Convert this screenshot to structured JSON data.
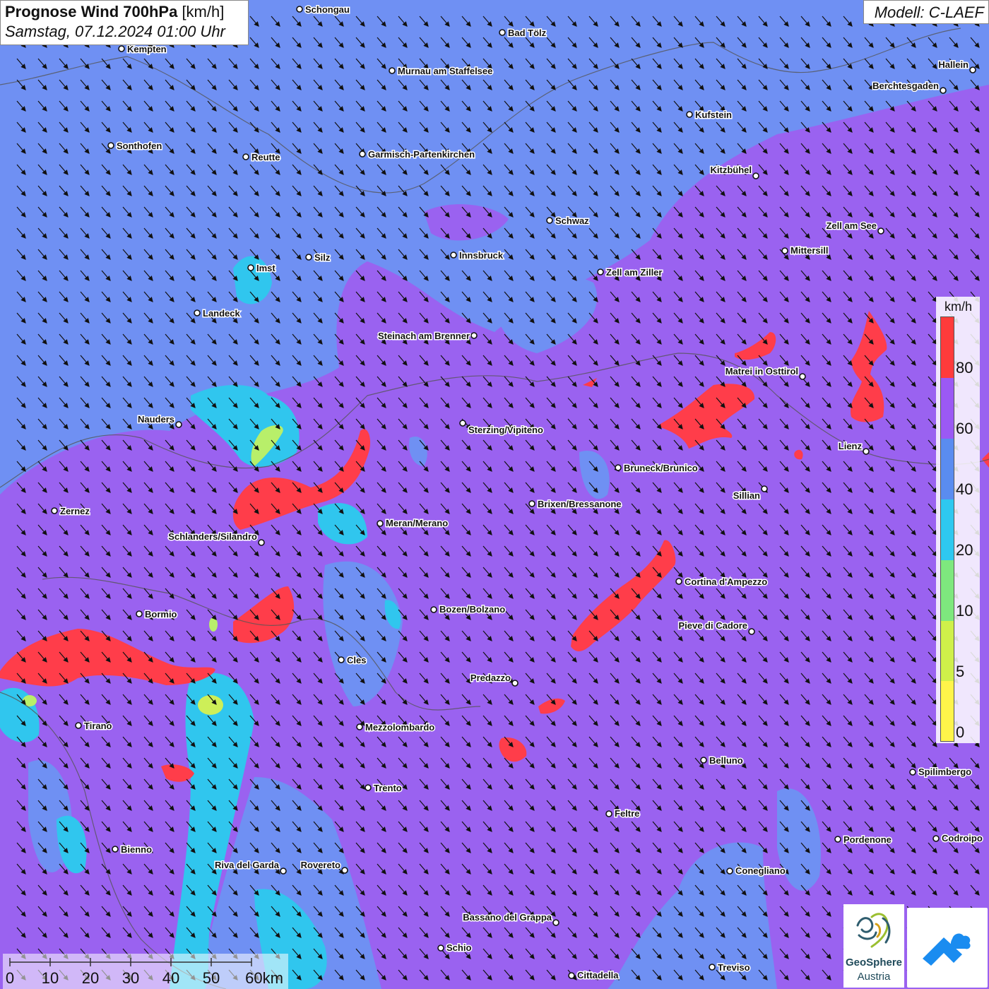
{
  "header": {
    "title": "Prognose Wind 700hPa",
    "unit": "[km/h]",
    "datetime": "Samstag, 07.12.2024 01:00 Uhr"
  },
  "model": {
    "label": "Modell: C-LAEF"
  },
  "legend": {
    "unit": "km/h",
    "ticks": [
      "80",
      "60",
      "40",
      "20",
      "10",
      "5",
      "0"
    ],
    "colors": [
      "#ff3b3b",
      "#9b59f4",
      "#5a8cf0",
      "#2ec8f0",
      "#7ee87e",
      "#cff04a",
      "#fff44a"
    ]
  },
  "scale": {
    "ticks": [
      "0",
      "10",
      "20",
      "30",
      "40",
      "50",
      "60km"
    ]
  },
  "branding": {
    "name_line1": "GeoSphere",
    "name_line2": "Austria"
  },
  "wind_direction": "northwest",
  "cities": [
    {
      "name": "Schongau"
    },
    {
      "name": "Bad Tölz"
    },
    {
      "name": "Kempten"
    },
    {
      "name": "Murnau am Staffelsee"
    },
    {
      "name": "Hallein"
    },
    {
      "name": "Berchtesgaden"
    },
    {
      "name": "Kufstein"
    },
    {
      "name": "Sonthofen"
    },
    {
      "name": "Reutte"
    },
    {
      "name": "Garmisch-Partenkirchen"
    },
    {
      "name": "Kitzbühel"
    },
    {
      "name": "Schwaz"
    },
    {
      "name": "Zell am See"
    },
    {
      "name": "Mittersill"
    },
    {
      "name": "Innsbruck"
    },
    {
      "name": "Silz"
    },
    {
      "name": "Imst"
    },
    {
      "name": "Zell am Ziller"
    },
    {
      "name": "Landeck"
    },
    {
      "name": "Steinach am Brenner"
    },
    {
      "name": "Matrei in Osttirol"
    },
    {
      "name": "Nauders"
    },
    {
      "name": "Sterzing/Vipiteno"
    },
    {
      "name": "Lienz"
    },
    {
      "name": "Bruneck/Brunico"
    },
    {
      "name": "Sillian"
    },
    {
      "name": "Brixen/Bressanone"
    },
    {
      "name": "Zernez"
    },
    {
      "name": "Meran/Merano"
    },
    {
      "name": "Schlanders/Silandro"
    },
    {
      "name": "Cortina d'Ampezzo"
    },
    {
      "name": "Bozen/Bolzano"
    },
    {
      "name": "Bormio"
    },
    {
      "name": "Pieve di Cadore"
    },
    {
      "name": "Cles"
    },
    {
      "name": "Predazzo"
    },
    {
      "name": "Tirano"
    },
    {
      "name": "Mezzolombardo"
    },
    {
      "name": "Belluno"
    },
    {
      "name": "Spilimbergo"
    },
    {
      "name": "Trento"
    },
    {
      "name": "Feltre"
    },
    {
      "name": "Bienno"
    },
    {
      "name": "Pordenone"
    },
    {
      "name": "Codroipo"
    },
    {
      "name": "Riva del Garda"
    },
    {
      "name": "Rovereto"
    },
    {
      "name": "Conegliano"
    },
    {
      "name": "Bassano del Grappa"
    },
    {
      "name": "Schio"
    },
    {
      "name": "Treviso"
    },
    {
      "name": "Cittadella"
    }
  ]
}
